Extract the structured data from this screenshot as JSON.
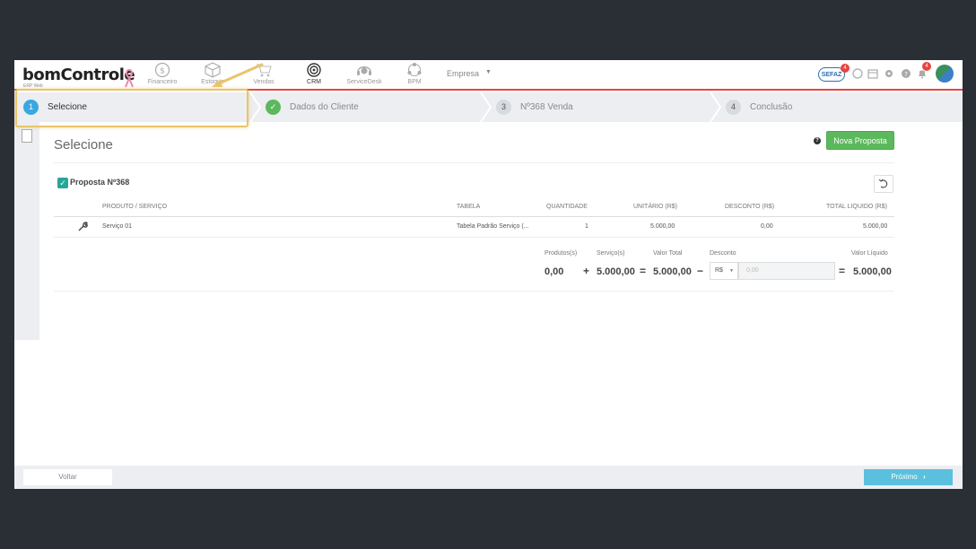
{
  "logo": {
    "text": "bomControle",
    "sub": "ERP Web"
  },
  "nav": {
    "items": [
      {
        "label": "Financeiro",
        "icon": "dollar-icon"
      },
      {
        "label": "Estoque",
        "icon": "box-icon"
      },
      {
        "label": "Vendas",
        "icon": "cart-icon"
      },
      {
        "label": "CRM",
        "icon": "target-icon"
      },
      {
        "label": "ServiceDesk",
        "icon": "headset-icon"
      },
      {
        "label": "BPM",
        "icon": "network-icon"
      }
    ],
    "company": "Empresa",
    "company_caret": "▼"
  },
  "topright": {
    "sefaz": "SEFAZ",
    "sefaz_badge": "4",
    "bell_badge": "4"
  },
  "steps": [
    {
      "num": "1",
      "label": "Selecione"
    },
    {
      "num": "✓",
      "label": "Dados do Cliente"
    },
    {
      "num": "3",
      "label": "Nº368 Venda"
    },
    {
      "num": "4",
      "label": "Conclusão"
    }
  ],
  "main": {
    "title": "Selecione",
    "help": "?",
    "new_button": "Nova Proposta",
    "checkbox": "✓",
    "proposal_title": "Proposta Nº368",
    "undo_icon": "↺",
    "columns": {
      "product": "PRODUTO / SERVIÇO",
      "table": "TABELA",
      "qty": "QUANTIDADE",
      "unit": "UNITÁRIO (R$)",
      "discount": "DESCONTO (R$)",
      "total": "TOTAL LIQUIDO (R$)"
    },
    "row": {
      "product": "Serviço 01",
      "table": "Tabela Padrão Serviço (...",
      "qty": "1",
      "unit": "5.000,00",
      "discount": "0,00",
      "total": "5.000,00"
    },
    "totals": {
      "products_label": "Produtos(s)",
      "products_value": "0,00",
      "plus": "+",
      "services_label": "Serviço(s)",
      "services_value": "5.000,00",
      "eq1": "=",
      "total_label": "Valor Total",
      "total_value": "5.000,00",
      "minus": "−",
      "discount_label": "Desconto",
      "currency": "R$",
      "currency_caret": "▼",
      "discount_placeholder": "0,00",
      "eq2": "=",
      "net_label": "Valor Líquido",
      "net_value": "5.000,00"
    }
  },
  "footer": {
    "back": "Voltar",
    "next": "Próximo",
    "next_icon": "›"
  },
  "colors": {
    "accent_green": "#5cb85c",
    "accent_blue": "#5bc0de",
    "step_blue": "#3aa7e0",
    "highlight": "#e9c46a",
    "nav_red": "#e8443f"
  }
}
